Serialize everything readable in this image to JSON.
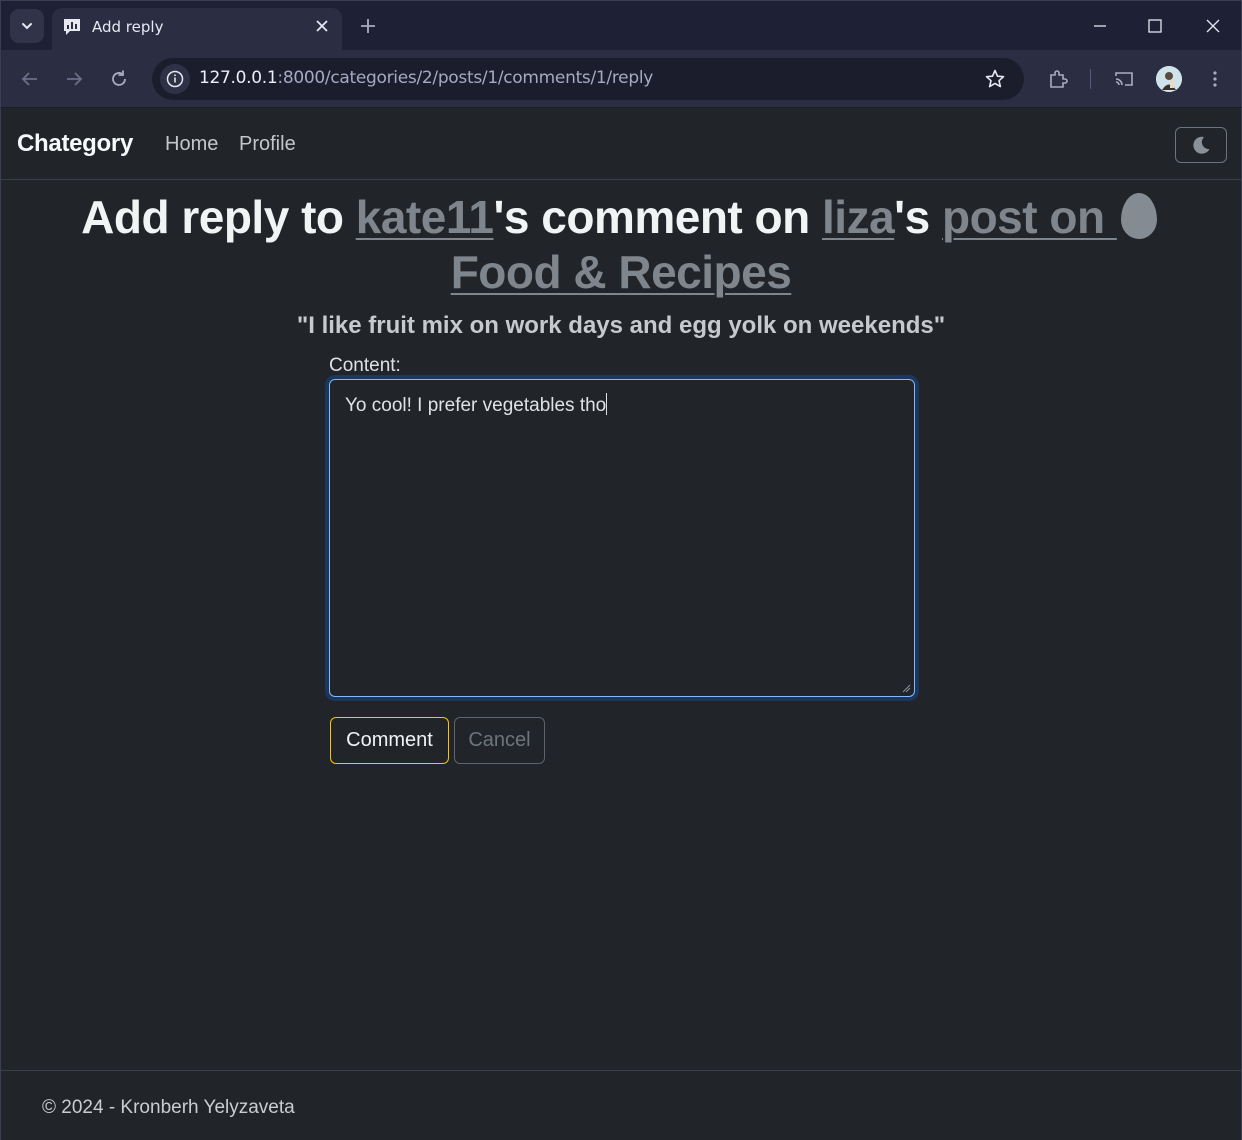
{
  "browser": {
    "tab_title": "Add reply",
    "url_host": "127.0.0.1",
    "url_path": ":8000/categories/2/posts/1/comments/1/reply"
  },
  "navbar": {
    "brand": "Chategory",
    "links": [
      "Home",
      "Profile"
    ]
  },
  "heading": {
    "prefix": "Add reply to ",
    "comment_author": "kate11",
    "mid": "'s comment on ",
    "post_author": "liza",
    "possessive": "'s ",
    "post_link_start": "post on ",
    "category": " Food & Recipes"
  },
  "quote": "\"I like fruit mix on work days and egg yolk on weekends\"",
  "form": {
    "content_label": "Content:",
    "content_value": "Yo cool! I prefer vegetables tho",
    "submit_label": "Comment",
    "cancel_label": "Cancel"
  },
  "footer": {
    "text": "© 2024 - Kronberh Yelyzaveta"
  },
  "colors": {
    "page_bg": "#212529",
    "link_muted": "#7f858c",
    "accent_warning": "#ffc107",
    "focus_border": "#86b7fe"
  },
  "icons": [
    "tab-search-icon",
    "site-favicon",
    "close-icon",
    "plus-icon",
    "minimize-icon",
    "maximize-icon",
    "window-close-icon",
    "back-icon",
    "forward-icon",
    "reload-icon",
    "info-icon",
    "star-icon",
    "extensions-icon",
    "cast-icon",
    "profile-avatar",
    "menu-icon",
    "moon-icon",
    "egg-icon"
  ]
}
